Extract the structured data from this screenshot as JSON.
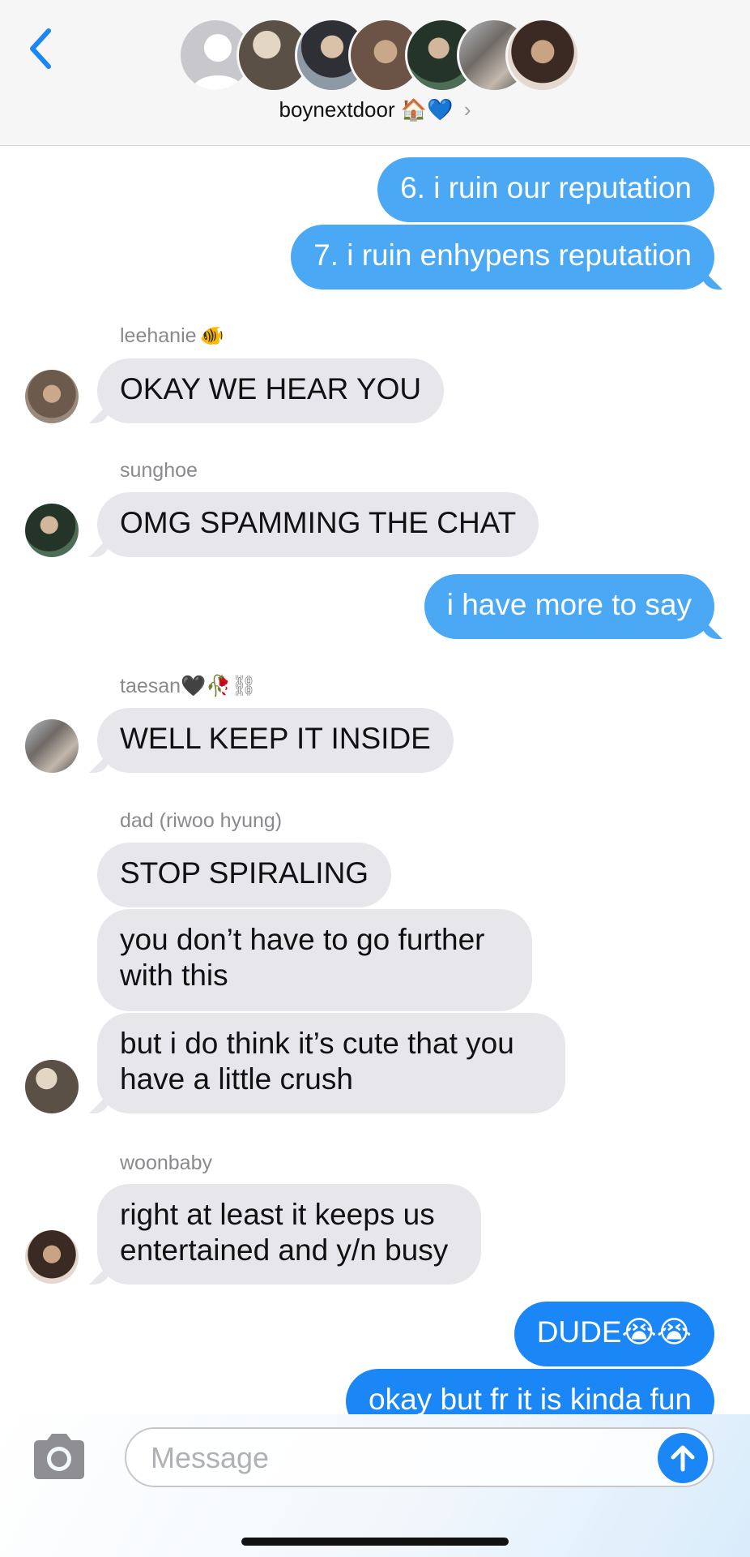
{
  "header": {
    "group_name": "boynextdoor",
    "group_emoji": "🏠💙",
    "chevron": "›",
    "icons": {
      "back": "chevron-left-icon",
      "placeholder_avatar": "person-icon"
    }
  },
  "messages": {
    "m1": "6. i ruin our reputation",
    "m2": "7. i ruin enhypens reputation",
    "s1_name": "leehanie",
    "s1_emoji": "🐠",
    "m3": "OKAY WE HEAR YOU",
    "s2_name": "sunghoe",
    "m4": "OMG SPAMMING THE CHAT",
    "m5": "i have more to say",
    "s3_name": "taesan🖤🥀⛓",
    "m6": "WELL KEEP IT INSIDE",
    "s4_name": "dad (riwoo hyung)",
    "m7": "STOP SPIRALING",
    "m8": "you don’t have to go further with this",
    "m9": "but i do think it’s cute that you have a little crush",
    "s5_name": "woonbaby",
    "m10": "right at least it keeps us entertained and y/n busy",
    "m11": "DUDE😭😭",
    "m12": "okay but fr it is kinda fun"
  },
  "composer": {
    "placeholder": "Message",
    "icons": {
      "camera": "camera-icon",
      "send": "arrow-up-icon"
    }
  },
  "colors": {
    "outgoing_light": "#4aa8f5",
    "outgoing_dark": "#1b86f5",
    "incoming": "#e6e6eb",
    "accent": "#1b86f5"
  }
}
